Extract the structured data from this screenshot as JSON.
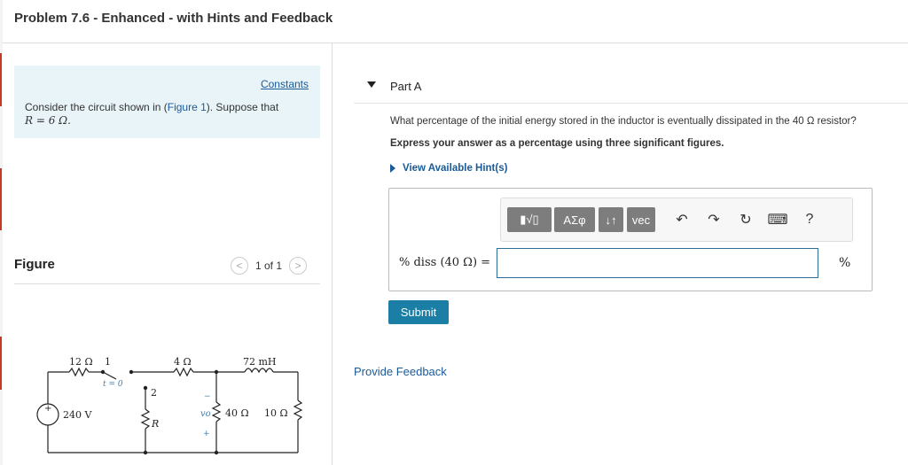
{
  "title": "Problem 7.6 - Enhanced - with Hints and Feedback",
  "left": {
    "constants_link": "Constants",
    "intro_before": "Consider the circuit shown in (",
    "figure_link": "Figure 1",
    "intro_after": "). Suppose that",
    "intro_math": "R = 6 Ω.",
    "figure_label": "Figure",
    "pager": "1 of 1",
    "prev": "<",
    "next": ">"
  },
  "circuit": {
    "r12": "12 Ω",
    "node1": "1",
    "t0": "t = 0",
    "node2": "2",
    "r4": "4 Ω",
    "l72": "72 mH",
    "source": "240 V",
    "plus": "+",
    "rR": "R",
    "vo": "vo",
    "minus": "−",
    "plus2": "+",
    "r40": "40 Ω",
    "r10": "10 Ω"
  },
  "partA": {
    "title": "Part A",
    "question": "What percentage of the initial energy stored in the inductor is eventually dissipated in the 40 Ω resistor?",
    "express": "Express your answer as a percentage using three significant figures.",
    "hints": "View Available Hint(s)",
    "toolbar": {
      "templates": "▮√▯",
      "greek": "ΑΣφ",
      "arrows": "↓↑",
      "vec": "vec",
      "undo": "↶",
      "redo": "↷",
      "reset": "↻",
      "keyboard": "⌨",
      "help": "?"
    },
    "answer_label": "% diss (40 Ω) =",
    "answer_value": "",
    "answer_unit": "%",
    "submit": "Submit",
    "feedback": "Provide Feedback"
  }
}
